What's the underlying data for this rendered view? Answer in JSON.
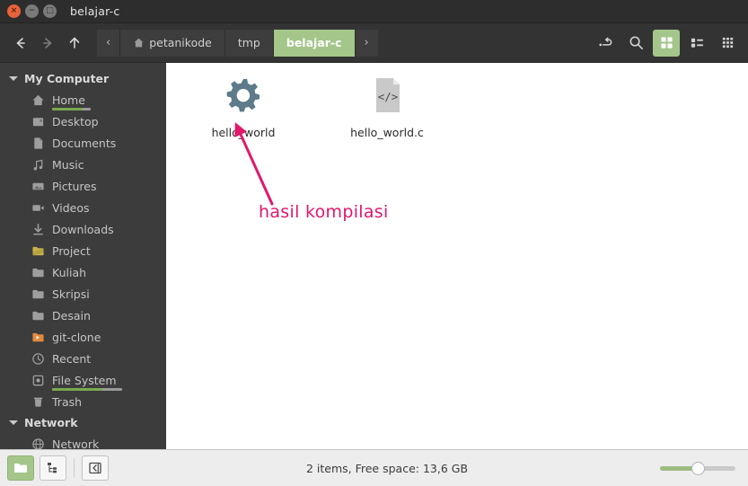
{
  "window": {
    "title": "belajar-c",
    "close_label": "×",
    "minimize_label": "−",
    "maximize_label": "□"
  },
  "toolbar": {
    "back_icon": "arrow-left-icon",
    "forward_icon": "arrow-right-icon",
    "up_icon": "arrow-up-icon",
    "prev_crumb_label": "‹",
    "next_crumb_label": "›",
    "breadcrumbs": [
      {
        "label": "petanikode",
        "icon": "home-icon",
        "active": false
      },
      {
        "label": "tmp",
        "icon": "",
        "active": false
      },
      {
        "label": "belajar-c",
        "icon": "",
        "active": true
      }
    ],
    "actions": [
      {
        "name": "toggle-location-bar",
        "icon": "path-toggle-icon",
        "active": false
      },
      {
        "name": "search",
        "icon": "search-icon",
        "active": false
      },
      {
        "name": "icon-view",
        "icon": "grid-view-icon",
        "active": true
      },
      {
        "name": "list-view",
        "icon": "list-view-icon",
        "active": false
      },
      {
        "name": "compact-view",
        "icon": "compact-view-icon",
        "active": false
      }
    ]
  },
  "sidebar": {
    "groups": [
      {
        "label": "My Computer",
        "items": [
          {
            "label": "Home",
            "icon": "home-icon",
            "capacity": 80
          },
          {
            "label": "Desktop",
            "icon": "desktop-folder-icon",
            "capacity": null
          },
          {
            "label": "Documents",
            "icon": "documents-icon",
            "capacity": null
          },
          {
            "label": "Music",
            "icon": "music-icon",
            "capacity": null
          },
          {
            "label": "Pictures",
            "icon": "pictures-icon",
            "capacity": null
          },
          {
            "label": "Videos",
            "icon": "videos-icon",
            "capacity": null
          },
          {
            "label": "Downloads",
            "icon": "downloads-icon",
            "capacity": null
          },
          {
            "label": "Project",
            "icon": "project-folder-icon",
            "capacity": null
          },
          {
            "label": "Kuliah",
            "icon": "folder-icon",
            "capacity": null
          },
          {
            "label": "Skripsi",
            "icon": "folder-icon",
            "capacity": null
          },
          {
            "label": "Desain",
            "icon": "folder-icon",
            "capacity": null
          },
          {
            "label": "git-clone",
            "icon": "bookmark-folder-icon",
            "capacity": null
          },
          {
            "label": "Recent",
            "icon": "clock-icon",
            "capacity": null
          },
          {
            "label": "File System",
            "icon": "drive-icon",
            "capacity": 72
          },
          {
            "label": "Trash",
            "icon": "trash-icon",
            "capacity": null
          }
        ]
      },
      {
        "label": "Network",
        "items": [
          {
            "label": "Network",
            "icon": "globe-icon",
            "capacity": null
          }
        ]
      }
    ]
  },
  "content": {
    "files": [
      {
        "name": "hello_world",
        "icon": "gear-executable-icon",
        "color": "#5d7b8a"
      },
      {
        "name": "hello_world.c",
        "icon": "code-document-icon",
        "color": "#c9c9c9"
      }
    ],
    "annotation": {
      "text": "hasil kompilasi",
      "color": "#e3176b",
      "arrow_icon": "arrow-pointer-icon"
    }
  },
  "statusbar": {
    "buttons": [
      {
        "name": "shortcuts-view",
        "icon": "folder-icon",
        "active": true
      },
      {
        "name": "tree-view",
        "icon": "tree-icon",
        "active": false
      },
      {
        "name": "toggle-sidebar",
        "icon": "sidebar-toggle-icon",
        "active": false
      }
    ],
    "text": "2 items, Free space: 13,6 GB",
    "zoom_percent": 50
  },
  "colors": {
    "accent_green": "#a4c68a",
    "annotation_pink": "#e3176b",
    "sidebar_bg": "#3c3c3c",
    "toolbar_bg": "#333333",
    "titlebar_bg": "#2d2d2d"
  }
}
